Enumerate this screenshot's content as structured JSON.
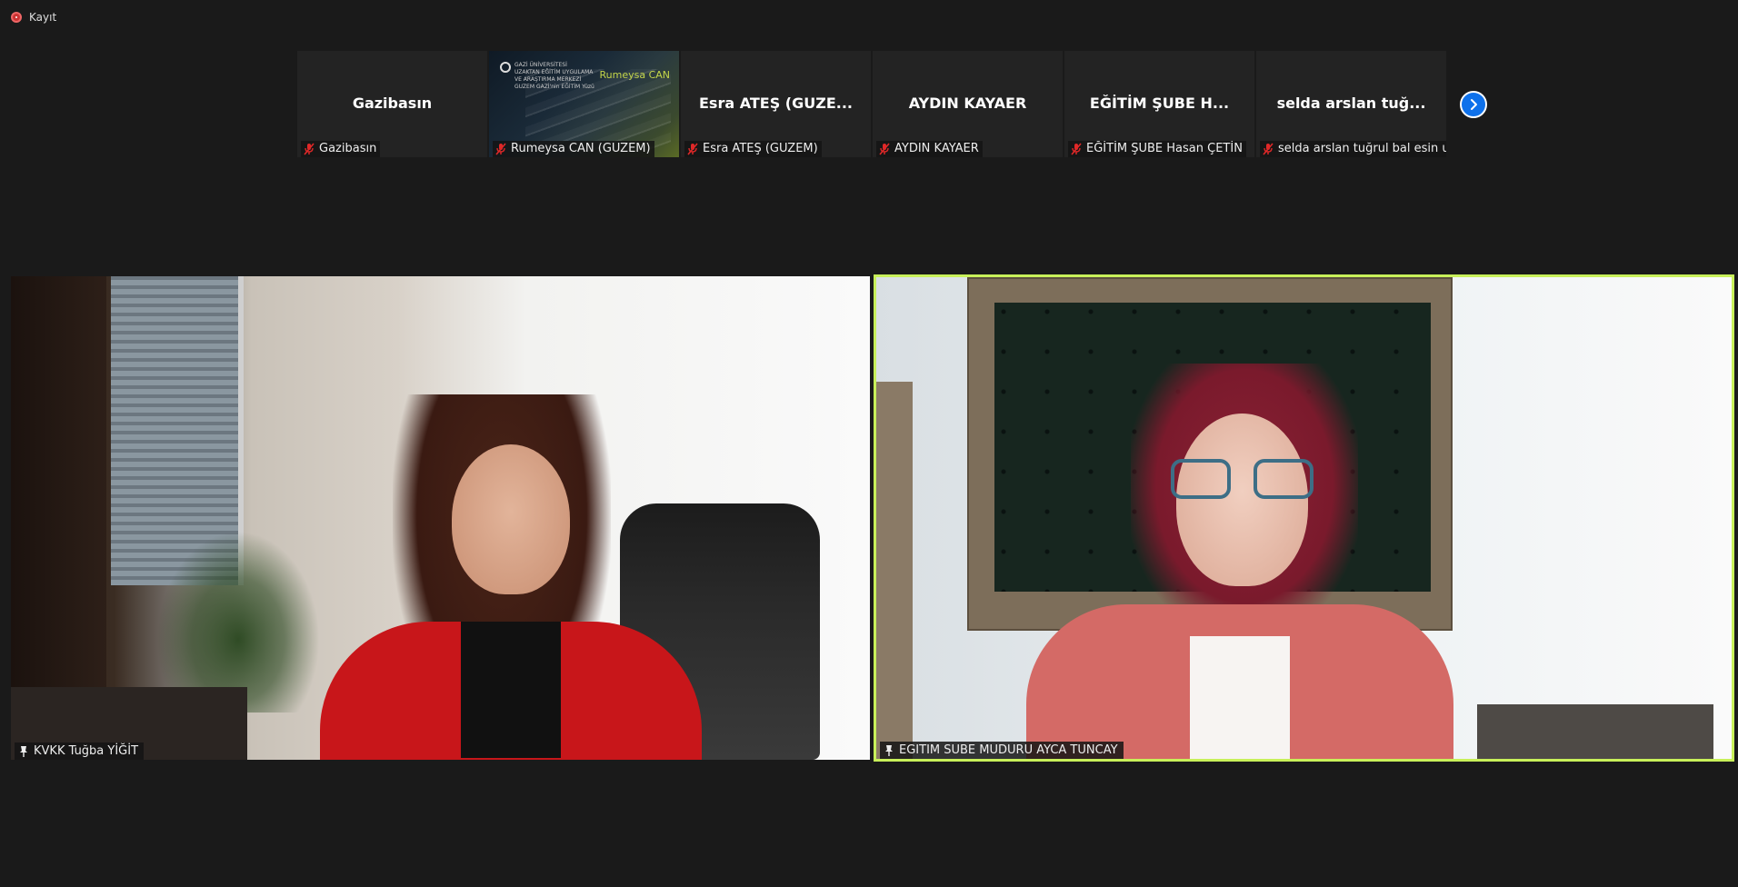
{
  "recording": {
    "label": "Kayıt"
  },
  "gallery": {
    "tiles": [
      {
        "title": "Gazibasın",
        "label": "Gazibasın",
        "type": "name"
      },
      {
        "title": "",
        "label": "Rumeysa CAN (GUZEM)",
        "type": "shared",
        "brand": "Rumeysa CAN",
        "logo_lines": [
          "GAZİ ÜNİVERSİTESİ",
          "UZAKTAN EĞİTİM UYGULAMA",
          "VE ARAŞTIRMA MERKEZİ",
          "GUZEM",
          "GAZİ'nin EĞİTİM Yüzü"
        ]
      },
      {
        "title": "Esra ATEŞ (GUZE...",
        "label": "Esra ATEŞ (GUZEM)",
        "type": "name"
      },
      {
        "title": "AYDIN KAYAER",
        "label": "AYDIN KAYAER",
        "type": "name"
      },
      {
        "title": "EĞİTİM ŞUBE H...",
        "label": "EĞİTİM ŞUBE Hasan ÇETİN",
        "type": "name"
      },
      {
        "title": "selda arslan tuğ...",
        "label": "selda arslan tuğrul bal esin uc...",
        "type": "name"
      }
    ],
    "next_icon": "chevron-right-icon"
  },
  "videos": {
    "left": {
      "name": "KVKK Tuğba YİĞİT",
      "pinned": true
    },
    "right": {
      "name": "EGITIM SUBE MUDURU AYCA TUNCAY",
      "pinned": true,
      "active_speaker": true
    }
  },
  "colors": {
    "background": "#1a1a1a",
    "accent": "#0e71eb",
    "speaker_highlight": "#c8f05a",
    "mic_off": "#e02828"
  }
}
